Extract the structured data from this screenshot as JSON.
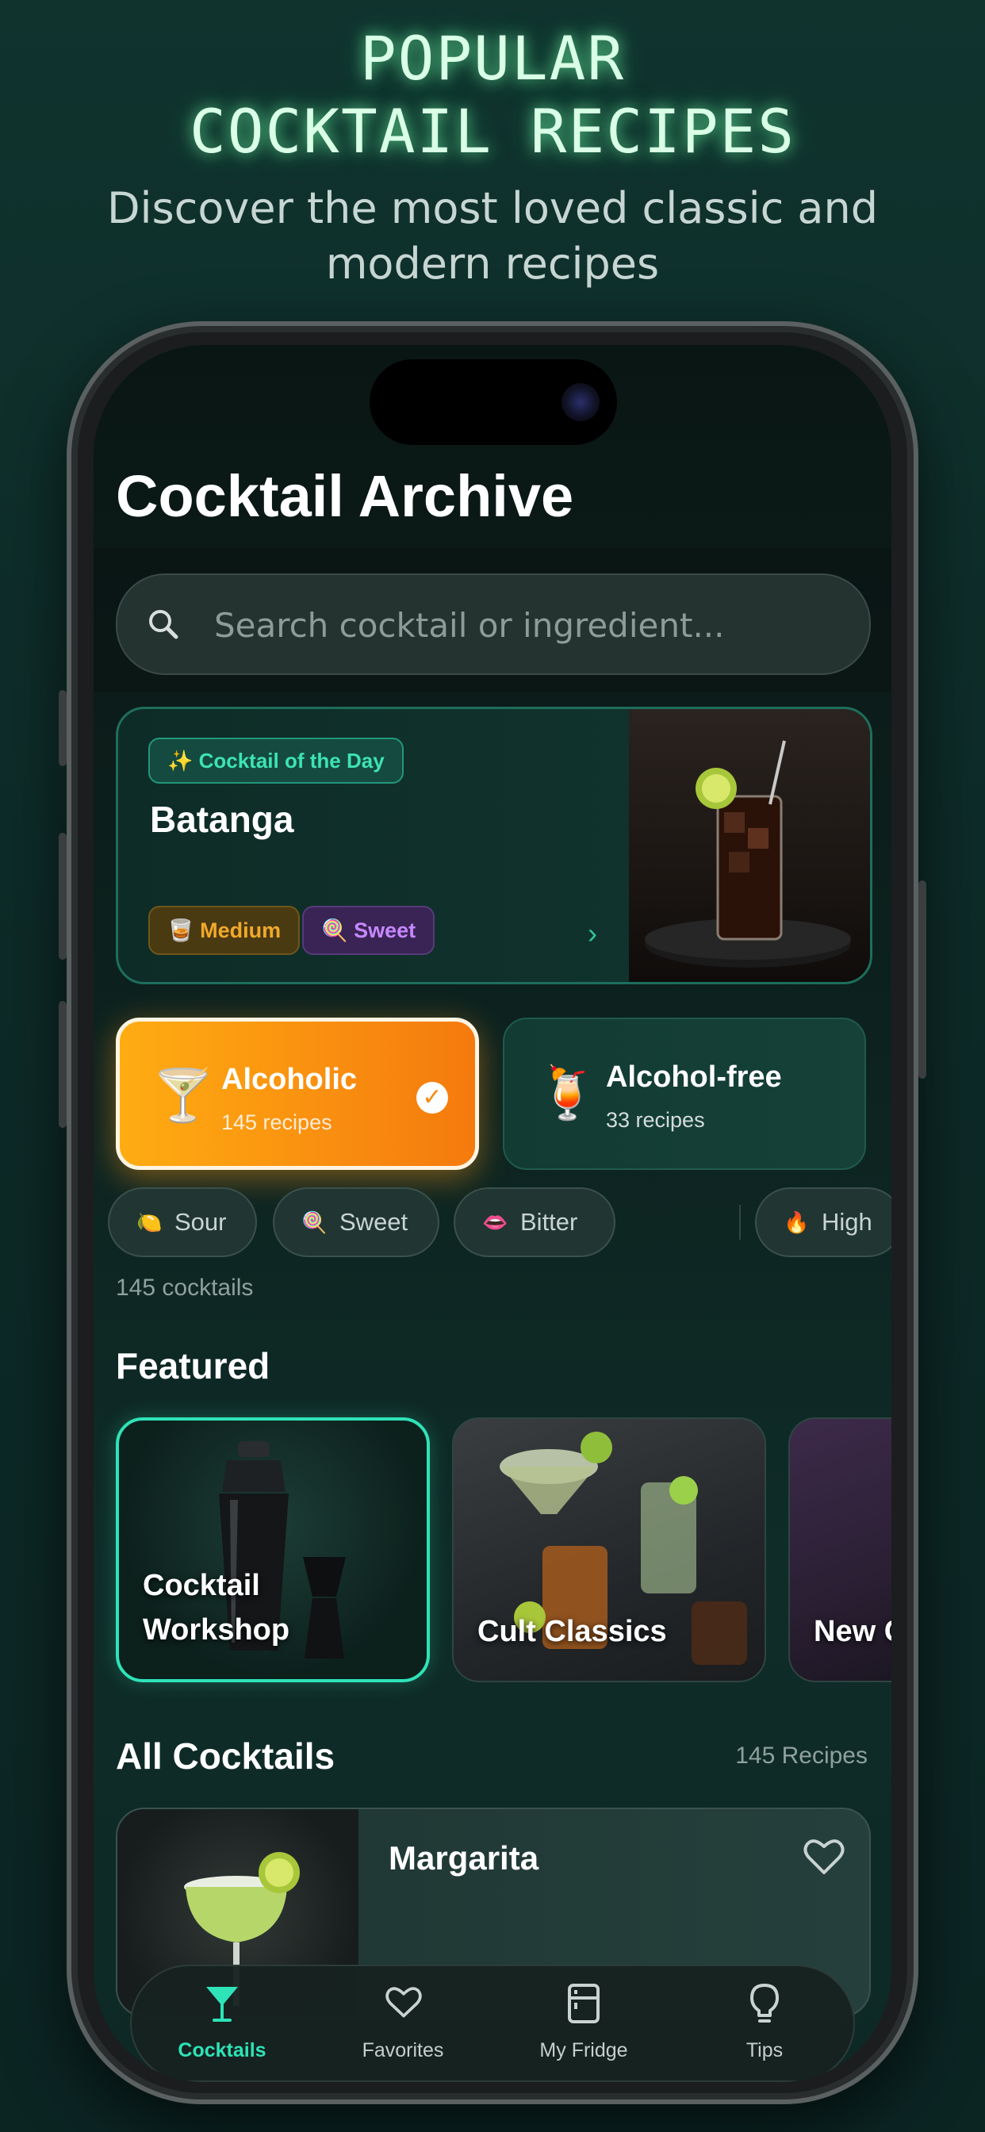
{
  "promo": {
    "title_line1": "POPULAR",
    "title_line2": "COCKTAIL RECIPES",
    "subtitle": "Discover the most loved classic and modern recipes"
  },
  "app": {
    "title": "Cocktail Archive",
    "search": {
      "placeholder": "Search cocktail or ingredient..."
    }
  },
  "cocktail_of_day": {
    "badge": "✨ Cocktail of the Day",
    "name": "Batanga",
    "tags": [
      {
        "icon": "🥃",
        "label": "Medium"
      },
      {
        "icon": "🍭",
        "label": "Sweet"
      }
    ]
  },
  "categories": [
    {
      "icon": "🍸",
      "name": "Alcoholic",
      "count": "145 recipes",
      "selected": true
    },
    {
      "icon": "🍹",
      "name": "Alcohol-free",
      "count": "33 recipes",
      "selected": false
    }
  ],
  "filters": [
    {
      "icon": "🍋",
      "label": "Sour"
    },
    {
      "icon": "🍭",
      "label": "Sweet"
    },
    {
      "icon": "👄",
      "label": "Bitter"
    },
    {
      "icon": "🔥",
      "label": "High"
    },
    {
      "icon": "🥃",
      "label": ""
    }
  ],
  "results_count": "145 cocktails",
  "featured": {
    "title": "Featured",
    "items": [
      "Cocktail Workshop",
      "Cult Classics",
      "New C"
    ]
  },
  "all_cocktails": {
    "title": "All Cocktails",
    "count": "145 Recipes",
    "first_item": "Margarita"
  },
  "tabbar": [
    {
      "icon": "cocktail-glass-icon",
      "label": "Cocktails",
      "active": true
    },
    {
      "icon": "heart-icon",
      "label": "Favorites",
      "active": false
    },
    {
      "icon": "fridge-icon",
      "label": "My Fridge",
      "active": false
    },
    {
      "icon": "lightbulb-icon",
      "label": "Tips",
      "active": false
    }
  ],
  "colors": {
    "accent": "#2ee3b8",
    "alcoholic_gradient_start": "#ffac12",
    "alcoholic_gradient_end": "#f57a0e",
    "background": "#0d2a27"
  }
}
